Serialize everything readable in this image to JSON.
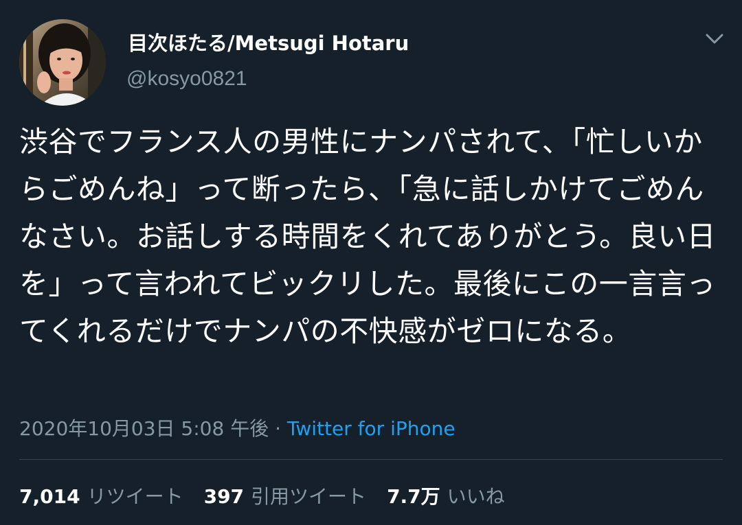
{
  "user": {
    "display_name": "目次ほたる/Metsugi Hotaru",
    "handle": "@kosyo0821"
  },
  "tweet": {
    "text": "渋谷でフランス人の男性にナンパされて、「忙しいからごめんね」って断ったら、「急に話しかけてごめんなさい。お話しする時間をくれてありがとう。良い日を」って言われてビックリした。最後にこの一言言ってくれるだけでナンパの不快感がゼロになる。",
    "timestamp": "2020年10月03日 5:08 午後",
    "separator": "·",
    "source": "Twitter for iPhone"
  },
  "stats": {
    "retweets": {
      "count": "7,014",
      "label": "リツイート"
    },
    "quotes": {
      "count": "397",
      "label": "引用ツイート"
    },
    "likes": {
      "count": "7.7万",
      "label": "いいね"
    }
  },
  "icons": {
    "caret": "chevron-down-icon",
    "avatar": "profile-photo"
  },
  "colors": {
    "background": "#15202b",
    "primary_text": "#ffffff",
    "secondary_text": "#8899a6",
    "link": "#1da1f2",
    "divider": "#38444d"
  }
}
